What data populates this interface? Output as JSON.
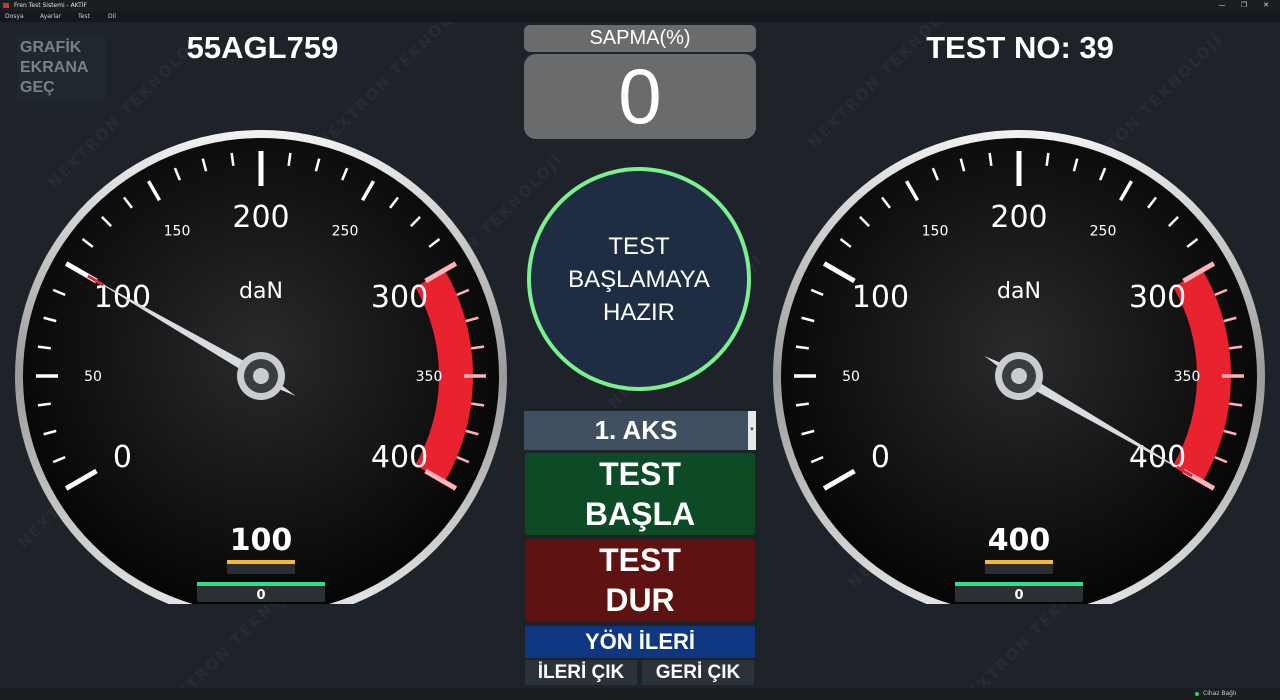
{
  "window": {
    "title": "Fren Test Sistemi - AKTİF",
    "controls": [
      "—",
      "❐",
      "✕"
    ]
  },
  "menu": [
    "Dosya",
    "Ayarlar",
    "Test",
    "Dil"
  ],
  "header": {
    "graphic_button": "GRAFİK\nEKRANA\nGEÇ",
    "plate": "55AGL759",
    "test_no": "TEST NO: 39"
  },
  "deviation": {
    "label": "SAPMA(%)",
    "value": "0"
  },
  "status_message": "TEST\nBAŞLAMAYA\nHAZIR",
  "axle_select": {
    "selected": "1. AKS"
  },
  "buttons": {
    "start": "TEST\nBAŞLA",
    "stop": "TEST\nDUR",
    "direction": "YÖN İLERİ",
    "exit_forward": "İLERİ ÇIK",
    "exit_back": "GERİ ÇIK"
  },
  "gauges": [
    {
      "id": "left",
      "unit": "daN",
      "min": 0,
      "max": 400,
      "needle_value": 100,
      "readout": "100",
      "bar_value": "0",
      "bar_fill": 1.0,
      "major_labels": [
        "0",
        "100",
        "200",
        "300",
        "400"
      ],
      "minor_labels": [
        "50",
        "150",
        "250",
        "350"
      ]
    },
    {
      "id": "right",
      "unit": "daN",
      "min": 0,
      "max": 400,
      "needle_value": 400,
      "readout": "400",
      "bar_value": "0",
      "bar_fill": 1.0,
      "major_labels": [
        "0",
        "100",
        "200",
        "300",
        "400"
      ],
      "minor_labels": [
        "50",
        "150",
        "250",
        "350"
      ]
    }
  ],
  "status_bar": {
    "connection": "Cihaz Bağlı"
  },
  "watermark": "NEXTRON TEKNOLOJİ",
  "colors": {
    "background": "#1e232a",
    "red_zone": "#e8222f",
    "ready_ring": "#7cf08e",
    "start_button": "#0d4a26",
    "stop_button": "#5f1212",
    "direction_button": "#0f3680",
    "readout_underline": "#f5b82e",
    "bar_fill": "#2ee08a"
  }
}
